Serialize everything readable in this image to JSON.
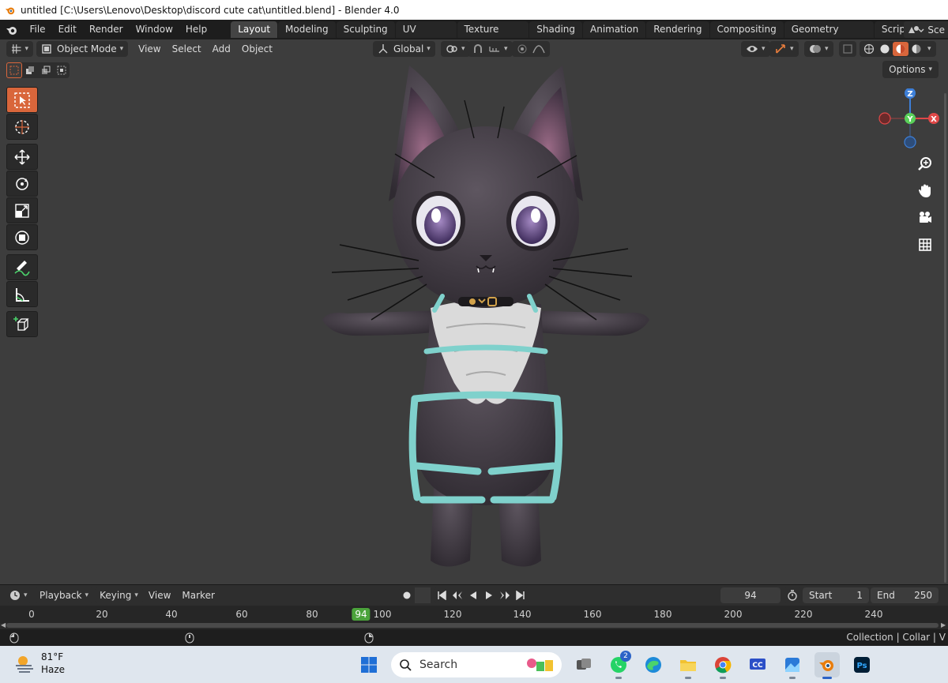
{
  "window": {
    "title": "untitled [C:\\Users\\Lenovo\\Desktop\\discord cute cat\\untitled.blend] - Blender 4.0"
  },
  "menu": [
    "File",
    "Edit",
    "Render",
    "Window",
    "Help"
  ],
  "workspaces": {
    "tabs": [
      "Layout",
      "Modeling",
      "Sculpting",
      "UV Editing",
      "Texture Paint",
      "Shading",
      "Animation",
      "Rendering",
      "Compositing",
      "Geometry Nodes",
      "Scripting"
    ],
    "active": "Layout",
    "scene_label": "Sce"
  },
  "viewport": {
    "mode": "Object Mode",
    "menus": [
      "View",
      "Select",
      "Add",
      "Object"
    ],
    "transform_orientation": "Global",
    "options_label": "Options",
    "gizmo": {
      "z": "Z",
      "y": "Y",
      "x": "X"
    }
  },
  "timeline": {
    "playback_label": "Playback",
    "keying_label": "Keying",
    "view_label": "View",
    "marker_label": "Marker",
    "current_frame": "94",
    "start_label": "Start",
    "start_value": "1",
    "end_label": "End",
    "end_value": "250",
    "ruler_ticks": [
      "0",
      "20",
      "40",
      "60",
      "80",
      "100",
      "120",
      "140",
      "160",
      "180",
      "200",
      "220",
      "240"
    ],
    "marker_frame": "94"
  },
  "statusbar": {
    "right_text": "Collection | Collar | V"
  },
  "taskbar": {
    "temperature": "81°F",
    "condition": "Haze",
    "search_placeholder": "Search",
    "whatsapp_badge": "2"
  },
  "colors": {
    "accent_orange": "#d9663b",
    "frame_green": "#4ba33b",
    "axis_x": "#e04848",
    "axis_y": "#5ad05a",
    "axis_z": "#3d7fd8"
  }
}
